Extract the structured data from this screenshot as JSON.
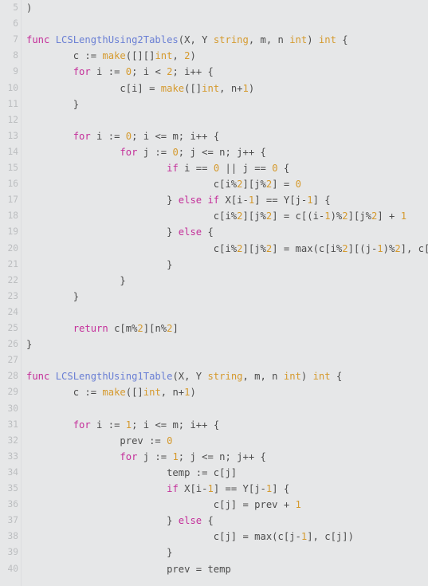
{
  "editor": {
    "language": "go",
    "theme": "light",
    "background_color": "#e6e7e8",
    "text_color": "#4d4d4d",
    "gutter_color": "#bcbec0",
    "first_visible_line": 5,
    "last_visible_line": 40,
    "syntax_colors": {
      "keyword": "#c4309a",
      "function_name": "#6a7fd4",
      "type": "#d59a2e",
      "number": "#d59a2e",
      "operator": "#4d4d4d",
      "identifier": "#4d4d4d"
    }
  },
  "lines": [
    {
      "number": 5,
      "tokens": [
        {
          "t": ")",
          "c": "tok-op"
        }
      ]
    },
    {
      "number": 6,
      "tokens": []
    },
    {
      "number": 7,
      "tokens": [
        {
          "t": "func ",
          "c": "tok-kw"
        },
        {
          "t": "LCSLengthUsing2Tables",
          "c": "tok-fn"
        },
        {
          "t": "(X, Y ",
          "c": "tok-op"
        },
        {
          "t": "string",
          "c": "tok-type"
        },
        {
          "t": ", m, n ",
          "c": "tok-op"
        },
        {
          "t": "int",
          "c": "tok-type"
        },
        {
          "t": ") ",
          "c": "tok-op"
        },
        {
          "t": "int",
          "c": "tok-type"
        },
        {
          "t": " {",
          "c": "tok-op"
        }
      ]
    },
    {
      "number": 8,
      "tokens": [
        {
          "t": "        c := ",
          "c": "tok-op"
        },
        {
          "t": "make",
          "c": "tok-type"
        },
        {
          "t": "([][]",
          "c": "tok-op"
        },
        {
          "t": "int",
          "c": "tok-type"
        },
        {
          "t": ", ",
          "c": "tok-op"
        },
        {
          "t": "2",
          "c": "tok-num"
        },
        {
          "t": ")",
          "c": "tok-op"
        }
      ]
    },
    {
      "number": 9,
      "tokens": [
        {
          "t": "        ",
          "c": "tok-op"
        },
        {
          "t": "for",
          "c": "tok-kw"
        },
        {
          "t": " i := ",
          "c": "tok-op"
        },
        {
          "t": "0",
          "c": "tok-num"
        },
        {
          "t": "; i < ",
          "c": "tok-op"
        },
        {
          "t": "2",
          "c": "tok-num"
        },
        {
          "t": "; i++ {",
          "c": "tok-op"
        }
      ]
    },
    {
      "number": 10,
      "tokens": [
        {
          "t": "                c[i] = ",
          "c": "tok-op"
        },
        {
          "t": "make",
          "c": "tok-type"
        },
        {
          "t": "([]",
          "c": "tok-op"
        },
        {
          "t": "int",
          "c": "tok-type"
        },
        {
          "t": ", n+",
          "c": "tok-op"
        },
        {
          "t": "1",
          "c": "tok-num"
        },
        {
          "t": ")",
          "c": "tok-op"
        }
      ]
    },
    {
      "number": 11,
      "tokens": [
        {
          "t": "        }",
          "c": "tok-op"
        }
      ]
    },
    {
      "number": 12,
      "tokens": []
    },
    {
      "number": 13,
      "tokens": [
        {
          "t": "        ",
          "c": "tok-op"
        },
        {
          "t": "for",
          "c": "tok-kw"
        },
        {
          "t": " i := ",
          "c": "tok-op"
        },
        {
          "t": "0",
          "c": "tok-num"
        },
        {
          "t": "; i <= m; i++ {",
          "c": "tok-op"
        }
      ]
    },
    {
      "number": 14,
      "tokens": [
        {
          "t": "                ",
          "c": "tok-op"
        },
        {
          "t": "for",
          "c": "tok-kw"
        },
        {
          "t": " j := ",
          "c": "tok-op"
        },
        {
          "t": "0",
          "c": "tok-num"
        },
        {
          "t": "; j <= n; j++ {",
          "c": "tok-op"
        }
      ]
    },
    {
      "number": 15,
      "tokens": [
        {
          "t": "                        ",
          "c": "tok-op"
        },
        {
          "t": "if",
          "c": "tok-kw"
        },
        {
          "t": " i == ",
          "c": "tok-op"
        },
        {
          "t": "0",
          "c": "tok-num"
        },
        {
          "t": " || j == ",
          "c": "tok-op"
        },
        {
          "t": "0",
          "c": "tok-num"
        },
        {
          "t": " {",
          "c": "tok-op"
        }
      ]
    },
    {
      "number": 16,
      "tokens": [
        {
          "t": "                                c[i%",
          "c": "tok-op"
        },
        {
          "t": "2",
          "c": "tok-num"
        },
        {
          "t": "][j%",
          "c": "tok-op"
        },
        {
          "t": "2",
          "c": "tok-num"
        },
        {
          "t": "] = ",
          "c": "tok-op"
        },
        {
          "t": "0",
          "c": "tok-num"
        }
      ]
    },
    {
      "number": 17,
      "tokens": [
        {
          "t": "                        } ",
          "c": "tok-op"
        },
        {
          "t": "else if",
          "c": "tok-kw"
        },
        {
          "t": " X[i-",
          "c": "tok-op"
        },
        {
          "t": "1",
          "c": "tok-num"
        },
        {
          "t": "] == Y[j-",
          "c": "tok-op"
        },
        {
          "t": "1",
          "c": "tok-num"
        },
        {
          "t": "] {",
          "c": "tok-op"
        }
      ]
    },
    {
      "number": 18,
      "tokens": [
        {
          "t": "                                c[i%",
          "c": "tok-op"
        },
        {
          "t": "2",
          "c": "tok-num"
        },
        {
          "t": "][j%",
          "c": "tok-op"
        },
        {
          "t": "2",
          "c": "tok-num"
        },
        {
          "t": "] = c[(i-",
          "c": "tok-op"
        },
        {
          "t": "1",
          "c": "tok-num"
        },
        {
          "t": ")%",
          "c": "tok-op"
        },
        {
          "t": "2",
          "c": "tok-num"
        },
        {
          "t": "][j%",
          "c": "tok-op"
        },
        {
          "t": "2",
          "c": "tok-num"
        },
        {
          "t": "] + ",
          "c": "tok-op"
        },
        {
          "t": "1",
          "c": "tok-num"
        }
      ]
    },
    {
      "number": 19,
      "tokens": [
        {
          "t": "                        } ",
          "c": "tok-op"
        },
        {
          "t": "else",
          "c": "tok-kw"
        },
        {
          "t": " {",
          "c": "tok-op"
        }
      ]
    },
    {
      "number": 20,
      "tokens": [
        {
          "t": "                                c[i%",
          "c": "tok-op"
        },
        {
          "t": "2",
          "c": "tok-num"
        },
        {
          "t": "][j%",
          "c": "tok-op"
        },
        {
          "t": "2",
          "c": "tok-num"
        },
        {
          "t": "] = max(c[i%",
          "c": "tok-op"
        },
        {
          "t": "2",
          "c": "tok-num"
        },
        {
          "t": "][(j-",
          "c": "tok-op"
        },
        {
          "t": "1",
          "c": "tok-num"
        },
        {
          "t": ")%",
          "c": "tok-op"
        },
        {
          "t": "2",
          "c": "tok-num"
        },
        {
          "t": "], c[",
          "c": "tok-op"
        }
      ]
    },
    {
      "number": 21,
      "tokens": [
        {
          "t": "                        }",
          "c": "tok-op"
        }
      ]
    },
    {
      "number": 22,
      "tokens": [
        {
          "t": "                }",
          "c": "tok-op"
        }
      ]
    },
    {
      "number": 23,
      "tokens": [
        {
          "t": "        }",
          "c": "tok-op"
        }
      ]
    },
    {
      "number": 24,
      "tokens": []
    },
    {
      "number": 25,
      "tokens": [
        {
          "t": "        ",
          "c": "tok-op"
        },
        {
          "t": "return",
          "c": "tok-kw"
        },
        {
          "t": " c[m%",
          "c": "tok-op"
        },
        {
          "t": "2",
          "c": "tok-num"
        },
        {
          "t": "][n%",
          "c": "tok-op"
        },
        {
          "t": "2",
          "c": "tok-num"
        },
        {
          "t": "]",
          "c": "tok-op"
        }
      ]
    },
    {
      "number": 26,
      "tokens": [
        {
          "t": "}",
          "c": "tok-op"
        }
      ]
    },
    {
      "number": 27,
      "tokens": []
    },
    {
      "number": 28,
      "tokens": [
        {
          "t": "func ",
          "c": "tok-kw"
        },
        {
          "t": "LCSLengthUsing1Table",
          "c": "tok-fn"
        },
        {
          "t": "(X, Y ",
          "c": "tok-op"
        },
        {
          "t": "string",
          "c": "tok-type"
        },
        {
          "t": ", m, n ",
          "c": "tok-op"
        },
        {
          "t": "int",
          "c": "tok-type"
        },
        {
          "t": ") ",
          "c": "tok-op"
        },
        {
          "t": "int",
          "c": "tok-type"
        },
        {
          "t": " {",
          "c": "tok-op"
        }
      ]
    },
    {
      "number": 29,
      "tokens": [
        {
          "t": "        c := ",
          "c": "tok-op"
        },
        {
          "t": "make",
          "c": "tok-type"
        },
        {
          "t": "([]",
          "c": "tok-op"
        },
        {
          "t": "int",
          "c": "tok-type"
        },
        {
          "t": ", n+",
          "c": "tok-op"
        },
        {
          "t": "1",
          "c": "tok-num"
        },
        {
          "t": ")",
          "c": "tok-op"
        }
      ]
    },
    {
      "number": 30,
      "tokens": []
    },
    {
      "number": 31,
      "tokens": [
        {
          "t": "        ",
          "c": "tok-op"
        },
        {
          "t": "for",
          "c": "tok-kw"
        },
        {
          "t": " i := ",
          "c": "tok-op"
        },
        {
          "t": "1",
          "c": "tok-num"
        },
        {
          "t": "; i <= m; i++ {",
          "c": "tok-op"
        }
      ]
    },
    {
      "number": 32,
      "tokens": [
        {
          "t": "                prev := ",
          "c": "tok-op"
        },
        {
          "t": "0",
          "c": "tok-num"
        }
      ]
    },
    {
      "number": 33,
      "tokens": [
        {
          "t": "                ",
          "c": "tok-op"
        },
        {
          "t": "for",
          "c": "tok-kw"
        },
        {
          "t": " j := ",
          "c": "tok-op"
        },
        {
          "t": "1",
          "c": "tok-num"
        },
        {
          "t": "; j <= n; j++ {",
          "c": "tok-op"
        }
      ]
    },
    {
      "number": 34,
      "tokens": [
        {
          "t": "                        temp := c[j]",
          "c": "tok-op"
        }
      ]
    },
    {
      "number": 35,
      "tokens": [
        {
          "t": "                        ",
          "c": "tok-op"
        },
        {
          "t": "if",
          "c": "tok-kw"
        },
        {
          "t": " X[i-",
          "c": "tok-op"
        },
        {
          "t": "1",
          "c": "tok-num"
        },
        {
          "t": "] == Y[j-",
          "c": "tok-op"
        },
        {
          "t": "1",
          "c": "tok-num"
        },
        {
          "t": "] {",
          "c": "tok-op"
        }
      ]
    },
    {
      "number": 36,
      "tokens": [
        {
          "t": "                                c[j] = prev + ",
          "c": "tok-op"
        },
        {
          "t": "1",
          "c": "tok-num"
        }
      ]
    },
    {
      "number": 37,
      "tokens": [
        {
          "t": "                        } ",
          "c": "tok-op"
        },
        {
          "t": "else",
          "c": "tok-kw"
        },
        {
          "t": " {",
          "c": "tok-op"
        }
      ]
    },
    {
      "number": 38,
      "tokens": [
        {
          "t": "                                c[j] = max(c[j-",
          "c": "tok-op"
        },
        {
          "t": "1",
          "c": "tok-num"
        },
        {
          "t": "], c[j])",
          "c": "tok-op"
        }
      ]
    },
    {
      "number": 39,
      "tokens": [
        {
          "t": "                        }",
          "c": "tok-op"
        }
      ]
    },
    {
      "number": 40,
      "tokens": [
        {
          "t": "                        prev = temp",
          "c": "tok-op"
        }
      ]
    }
  ]
}
